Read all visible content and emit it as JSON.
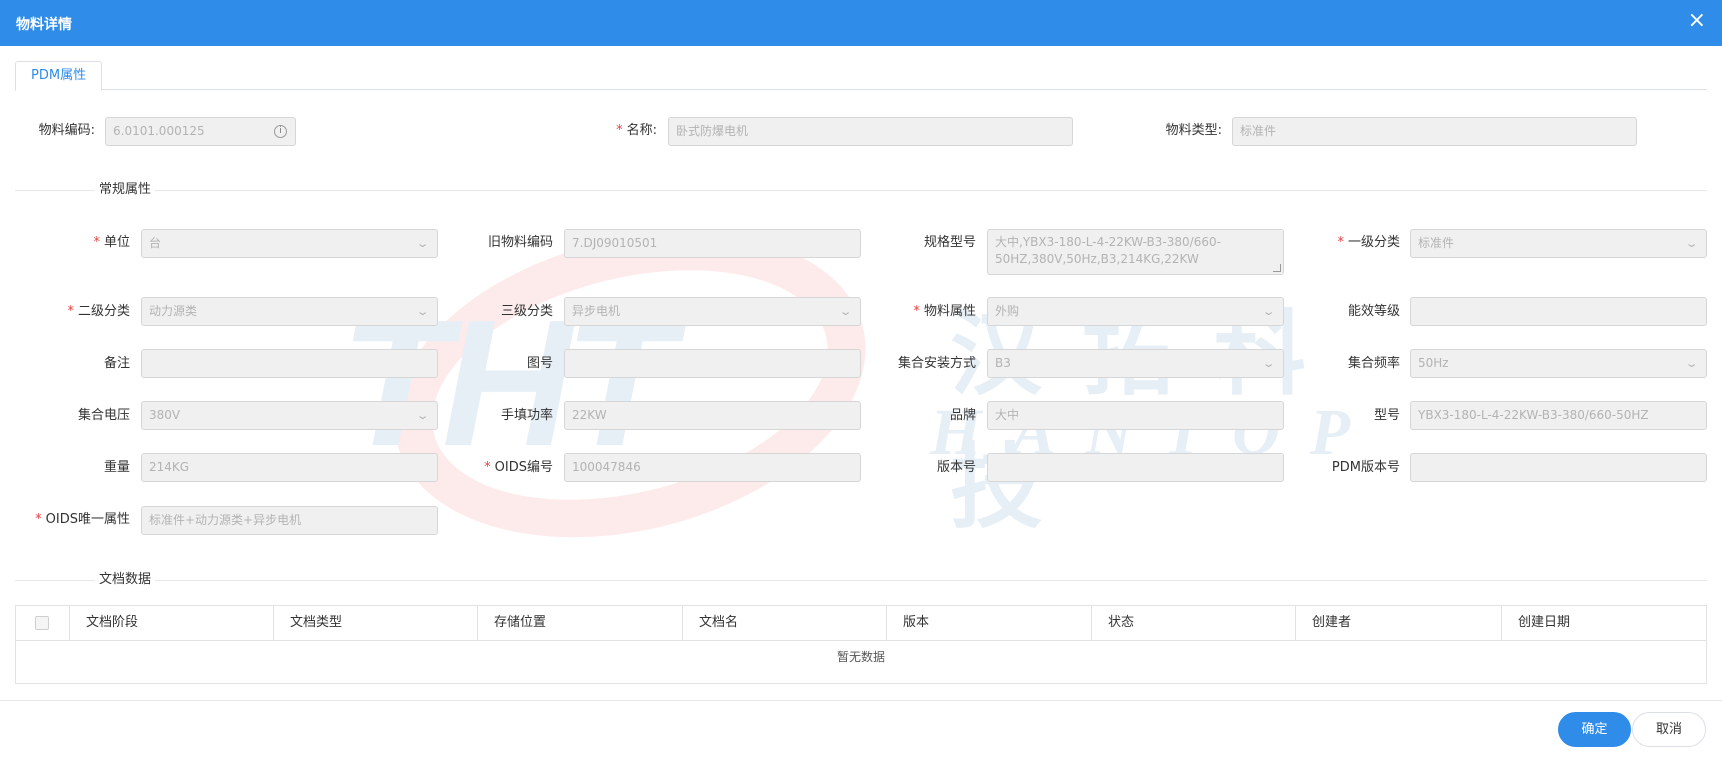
{
  "dialog": {
    "title": "物料详情"
  },
  "tabs": [
    {
      "label": "PDM属性"
    }
  ],
  "header_fields": {
    "code": {
      "label": "物料编码:",
      "value": "6.0101.000125"
    },
    "name": {
      "label": "名称:",
      "value": "卧式防爆电机"
    },
    "type": {
      "label": "物料类型:",
      "value": "标准件"
    }
  },
  "sections": {
    "general": "常规属性",
    "documents": "文档数据"
  },
  "fields": {
    "unit": {
      "label": "单位",
      "value": "台"
    },
    "old_code": {
      "label": "旧物料编码",
      "value": "7.DJ09010501"
    },
    "spec": {
      "label": "规格型号",
      "value": "大中,YBX3-180-L-4-22KW-B3-380/660-50HZ,380V,50Hz,B3,214KG,22KW"
    },
    "class1": {
      "label": "一级分类",
      "value": "标准件"
    },
    "class2": {
      "label": "二级分类",
      "value": "动力源类"
    },
    "class3": {
      "label": "三级分类",
      "value": "异步电机"
    },
    "material_attr": {
      "label": "物料属性",
      "value": "外购"
    },
    "energy_level": {
      "label": "能效等级",
      "value": ""
    },
    "remark": {
      "label": "备注",
      "value": ""
    },
    "drawing_no": {
      "label": "图号",
      "value": ""
    },
    "install_mode": {
      "label": "集合安装方式",
      "value": "B3"
    },
    "frequency": {
      "label": "集合频率",
      "value": "50Hz"
    },
    "voltage": {
      "label": "集合电压",
      "value": "380V"
    },
    "power": {
      "label": "手填功率",
      "value": "22KW"
    },
    "brand": {
      "label": "品牌",
      "value": "大中"
    },
    "model": {
      "label": "型号",
      "value": "YBX3-180-L-4-22KW-B3-380/660-50HZ"
    },
    "weight": {
      "label": "重量",
      "value": "214KG"
    },
    "oids_code": {
      "label": "OIDS编号",
      "value": "100047846"
    },
    "version_no": {
      "label": "版本号",
      "value": ""
    },
    "pdm_version": {
      "label": "PDM版本号",
      "value": ""
    },
    "oids_unique": {
      "label": "OIDS唯一属性",
      "value": "标准件+动力源类+异步电机"
    }
  },
  "required_mark": "*",
  "table": {
    "columns": [
      "文档阶段",
      "文档类型",
      "存储位置",
      "文档名",
      "版本",
      "状态",
      "创建者",
      "创建日期"
    ],
    "empty_text": "暂无数据"
  },
  "buttons": {
    "ok": "确定",
    "cancel": "取消"
  },
  "watermark": {
    "logo": "THT",
    "cn": "汉拓科技",
    "en": "HANTOP"
  },
  "colors": {
    "primary": "#2f8ce8",
    "required": "#e64242"
  },
  "icons": {
    "close": "×",
    "dropdown": "⌄",
    "info": "i"
  }
}
